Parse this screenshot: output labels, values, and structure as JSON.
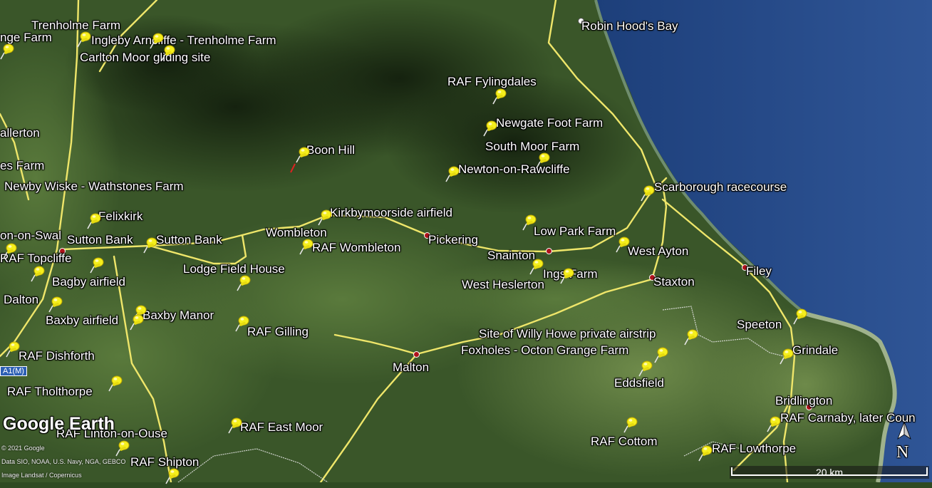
{
  "colors": {
    "land_dark": "#1f3318",
    "land": "#3f5e2c",
    "sea": "#2b4e8f",
    "road": "#f0e86a",
    "pin": "#f3ee1a",
    "town_dot": "#b0121b"
  },
  "places": [
    {
      "id": "trenholme-farm",
      "label": "Trenholme Farm"
    },
    {
      "id": "grange-farm",
      "label": "nge Farm"
    },
    {
      "id": "ingleby-arncliffe",
      "label": "Ingleby Arncliffe - Trenholme Farm"
    },
    {
      "id": "carlton-moor",
      "label": "Carlton Moor gliding site"
    },
    {
      "id": "allerton",
      "label": "allerton"
    },
    {
      "id": "es-farm",
      "label": "es Farm"
    },
    {
      "id": "newby-wiske",
      "label": "Newby Wiske - Wathstones Farm"
    },
    {
      "id": "felixkirk",
      "label": "Felixkirk"
    },
    {
      "id": "on-swale",
      "label": "on-on-Swal"
    },
    {
      "id": "sutton-bank-1",
      "label": "Sutton Bank"
    },
    {
      "id": "sutton-bank-2",
      "label": "Sutton Bank"
    },
    {
      "id": "raf-topcliffe",
      "label": "RAF Topcliffe"
    },
    {
      "id": "bagby-airfield",
      "label": "Bagby airfield"
    },
    {
      "id": "dalton",
      "label": "Dalton"
    },
    {
      "id": "baxby-airfield",
      "label": "Baxby airfield"
    },
    {
      "id": "baxby-manor",
      "label": "Baxby Manor"
    },
    {
      "id": "raf-dishforth",
      "label": "RAF Dishforth"
    },
    {
      "id": "raf-tholthorpe",
      "label": "RAF Tholthorpe"
    },
    {
      "id": "raf-linton",
      "label": "RAF Linton-on-Ouse"
    },
    {
      "id": "raf-shipton",
      "label": "RAF Shipton"
    },
    {
      "id": "boon-hill",
      "label": "Boon Hill"
    },
    {
      "id": "kirkbymoorside",
      "label": "Kirkbymoorside airfield"
    },
    {
      "id": "wombleton",
      "label": "Wombleton"
    },
    {
      "id": "raf-wombleton",
      "label": "RAF Wombleton"
    },
    {
      "id": "lodge-field-house",
      "label": "Lodge Field House"
    },
    {
      "id": "raf-gilling",
      "label": "RAF Gilling"
    },
    {
      "id": "raf-east-moor",
      "label": "RAF East Moor"
    },
    {
      "id": "malton",
      "label": "Malton"
    },
    {
      "id": "pickering",
      "label": "Pickering"
    },
    {
      "id": "robin-hoods-bay",
      "label": "Robin Hood's Bay"
    },
    {
      "id": "raf-fylingdales",
      "label": "RAF Fylingdales"
    },
    {
      "id": "newgate-foot-farm",
      "label": "Newgate Foot Farm"
    },
    {
      "id": "south-moor-farm",
      "label": "South Moor Farm"
    },
    {
      "id": "newton-on-rawcliffe",
      "label": "Newton-on-Rawcliffe"
    },
    {
      "id": "scarborough-racecourse",
      "label": "Scarborough racecourse"
    },
    {
      "id": "low-park-farm",
      "label": "Low Park Farm"
    },
    {
      "id": "snainton",
      "label": "Snainton"
    },
    {
      "id": "west-ayton",
      "label": "West Ayton"
    },
    {
      "id": "ings-farm",
      "label": "Ings Farm"
    },
    {
      "id": "west-heslerton",
      "label": "West Heslerton"
    },
    {
      "id": "staxton",
      "label": "Staxton"
    },
    {
      "id": "filey",
      "label": "Filey"
    },
    {
      "id": "speeton",
      "label": "Speeton"
    },
    {
      "id": "grindale",
      "label": "Grindale"
    },
    {
      "id": "willy-howe",
      "label": "Site of Willy Howe private airstrip"
    },
    {
      "id": "foxholes",
      "label": "Foxholes - Octon Grange Farm"
    },
    {
      "id": "eddsfield",
      "label": "Eddsfield"
    },
    {
      "id": "bridlington",
      "label": "Bridlington"
    },
    {
      "id": "raf-carnaby",
      "label": "RAF Carnaby, later Coun"
    },
    {
      "id": "raf-cottom",
      "label": "RAF Cottom"
    },
    {
      "id": "raf-lowthorpe",
      "label": "RAF Lowthorpe"
    }
  ],
  "road_badge": "A1(M)",
  "branding": {
    "logo": "Google Earth",
    "copyright": "© 2021 Google",
    "data_credit": "Data SIO, NOAA, U.S. Navy, NGA, GEBCO",
    "image_credit": "Image Landsat / Copernicus"
  },
  "scale": {
    "label": "20 km"
  },
  "compass": {
    "label": "N"
  }
}
